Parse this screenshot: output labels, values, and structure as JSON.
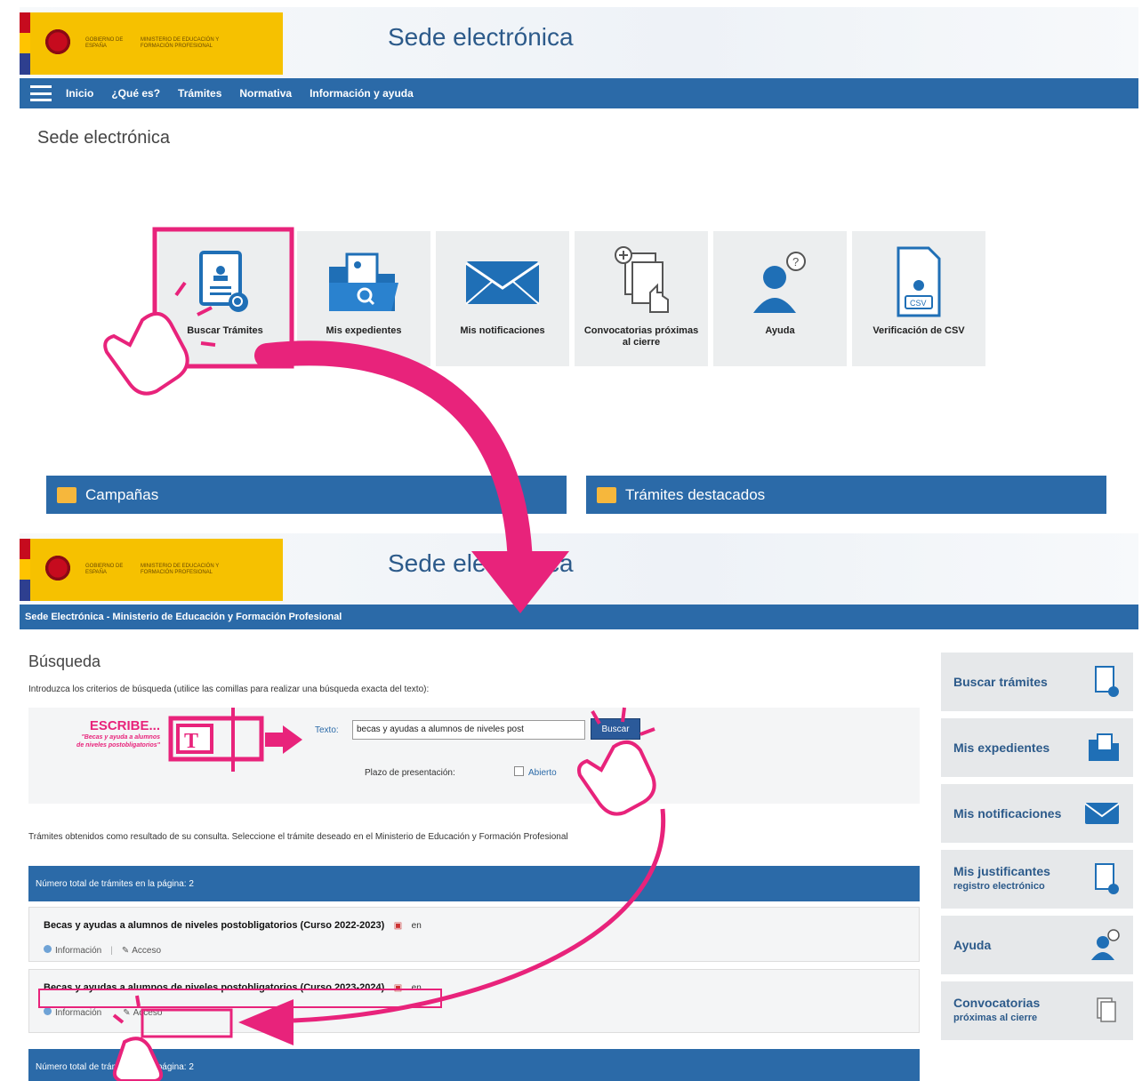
{
  "top": {
    "header": {
      "gov_text": "GOBIERNO DE ESPAÑA",
      "ministry_text": "MINISTERIO DE EDUCACIÓN Y FORMACIÓN PROFESIONAL",
      "site_title": "Sede electrónica"
    },
    "nav": [
      "Inicio",
      "¿Qué es?",
      "Trámites",
      "Normativa",
      "Información y ayuda"
    ],
    "page_heading": "Sede electrónica",
    "tiles": [
      {
        "label": "Buscar Trámites",
        "icon": "document-search-icon"
      },
      {
        "label": "Mis expedientes",
        "icon": "folder-search-icon"
      },
      {
        "label": "Mis notificaciones",
        "icon": "envelope-icon"
      },
      {
        "label": "Convocatorias próximas al cierre",
        "icon": "documents-hand-icon"
      },
      {
        "label": "Ayuda",
        "icon": "person-help-icon"
      },
      {
        "label": "Verificación de CSV",
        "icon": "csv-document-icon"
      }
    ],
    "panels": [
      "Campañas",
      "Trámites destacados"
    ]
  },
  "bottom": {
    "header": {
      "gov_text": "GOBIERNO DE ESPAÑA",
      "ministry_text": "MINISTERIO DE EDUCACIÓN Y FORMACIÓN PROFESIONAL",
      "site_title": "Sede electrónica"
    },
    "site_bar": "Sede Electrónica - Ministerio de Educación y Formación Profesional",
    "search_title": "Búsqueda",
    "search_intro": "Introduzca los criterios de búsqueda (utilice las comillas para realizar una búsqueda exacta del texto):",
    "text_label": "Texto:",
    "text_value": "becas y ayudas a alumnos de niveles post",
    "buscar_label": "Buscar",
    "plazo_label": "Plazo de presentación:",
    "plazo_option": "Abierto",
    "results_info": "Trámites obtenidos como resultado de su consulta. Seleccione el trámite deseado en el Ministerio de Educación y Formación Profesional",
    "total_label": "Número total de trámites en la página: 2",
    "results": [
      {
        "title": "Becas y ayudas a alumnos de niveles postobligatorios (Curso 2022-2023)",
        "en": "en",
        "info": "Información",
        "access": "Acceso"
      },
      {
        "title": "Becas y ayudas a alumnos de niveles postobligatorios (Curso 2023-2024)",
        "en": "en",
        "info": "Información",
        "access": "Acceso"
      }
    ],
    "sidebar": [
      {
        "label": "Buscar trámites",
        "sub": "",
        "icon": "document-search-icon"
      },
      {
        "label": "Mis expedientes",
        "sub": "",
        "icon": "folder-search-icon"
      },
      {
        "label": "Mis notificaciones",
        "sub": "",
        "icon": "envelope-icon"
      },
      {
        "label": "Mis justificantes",
        "sub": "registro electrónico",
        "icon": "receipt-icon"
      },
      {
        "label": "Ayuda",
        "sub": "",
        "icon": "person-help-icon"
      },
      {
        "label": "Convocatorias",
        "sub": "próximas al cierre",
        "icon": "documents-hand-icon"
      }
    ]
  },
  "annotations": {
    "escribe": "ESCRIBE...",
    "escribe_quote": "\"Becas y ayuda a alumnos de niveles postobligatorios\"",
    "accent_color": "#e8237b"
  }
}
